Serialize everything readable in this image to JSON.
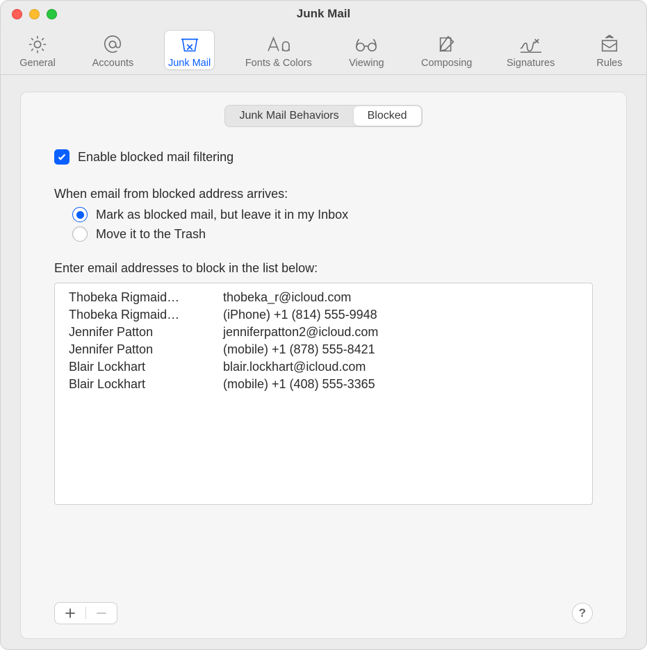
{
  "window": {
    "title": "Junk Mail"
  },
  "toolbar": {
    "items": [
      {
        "id": "general",
        "label": "General"
      },
      {
        "id": "accounts",
        "label": "Accounts"
      },
      {
        "id": "junk-mail",
        "label": "Junk Mail"
      },
      {
        "id": "fonts",
        "label": "Fonts & Colors"
      },
      {
        "id": "viewing",
        "label": "Viewing"
      },
      {
        "id": "composing",
        "label": "Composing"
      },
      {
        "id": "signatures",
        "label": "Signatures"
      },
      {
        "id": "rules",
        "label": "Rules"
      }
    ],
    "selected": "junk-mail"
  },
  "tabs": {
    "behaviors": "Junk Mail Behaviors",
    "blocked": "Blocked",
    "selected": "blocked"
  },
  "options": {
    "enable_blocked_filtering": {
      "checked": true,
      "label": "Enable blocked mail filtering"
    },
    "arrival_heading": "When email from blocked address arrives:",
    "arrival_choice": "mark",
    "mark_label": "Mark as blocked mail, but leave it in my Inbox",
    "trash_label": "Move it to the Trash",
    "list_heading": "Enter email addresses to block in the list below:"
  },
  "blocked_list": [
    {
      "name": "Thobeka Rigmaid…",
      "info": "thobeka_r@icloud.com"
    },
    {
      "name": "Thobeka Rigmaid…",
      "info": "(iPhone) +1 (814) 555-9948"
    },
    {
      "name": "Jennifer Patton",
      "info": "jenniferpatton2@icloud.com"
    },
    {
      "name": "Jennifer Patton",
      "info": "(mobile) +1 (878) 555-8421"
    },
    {
      "name": "Blair Lockhart",
      "info": "blair.lockhart@icloud.com"
    },
    {
      "name": "Blair Lockhart",
      "info": "(mobile) +1 (408) 555-3365"
    }
  ],
  "footer": {
    "add_tooltip": "Add",
    "remove_tooltip": "Remove",
    "help_tooltip": "Help"
  }
}
